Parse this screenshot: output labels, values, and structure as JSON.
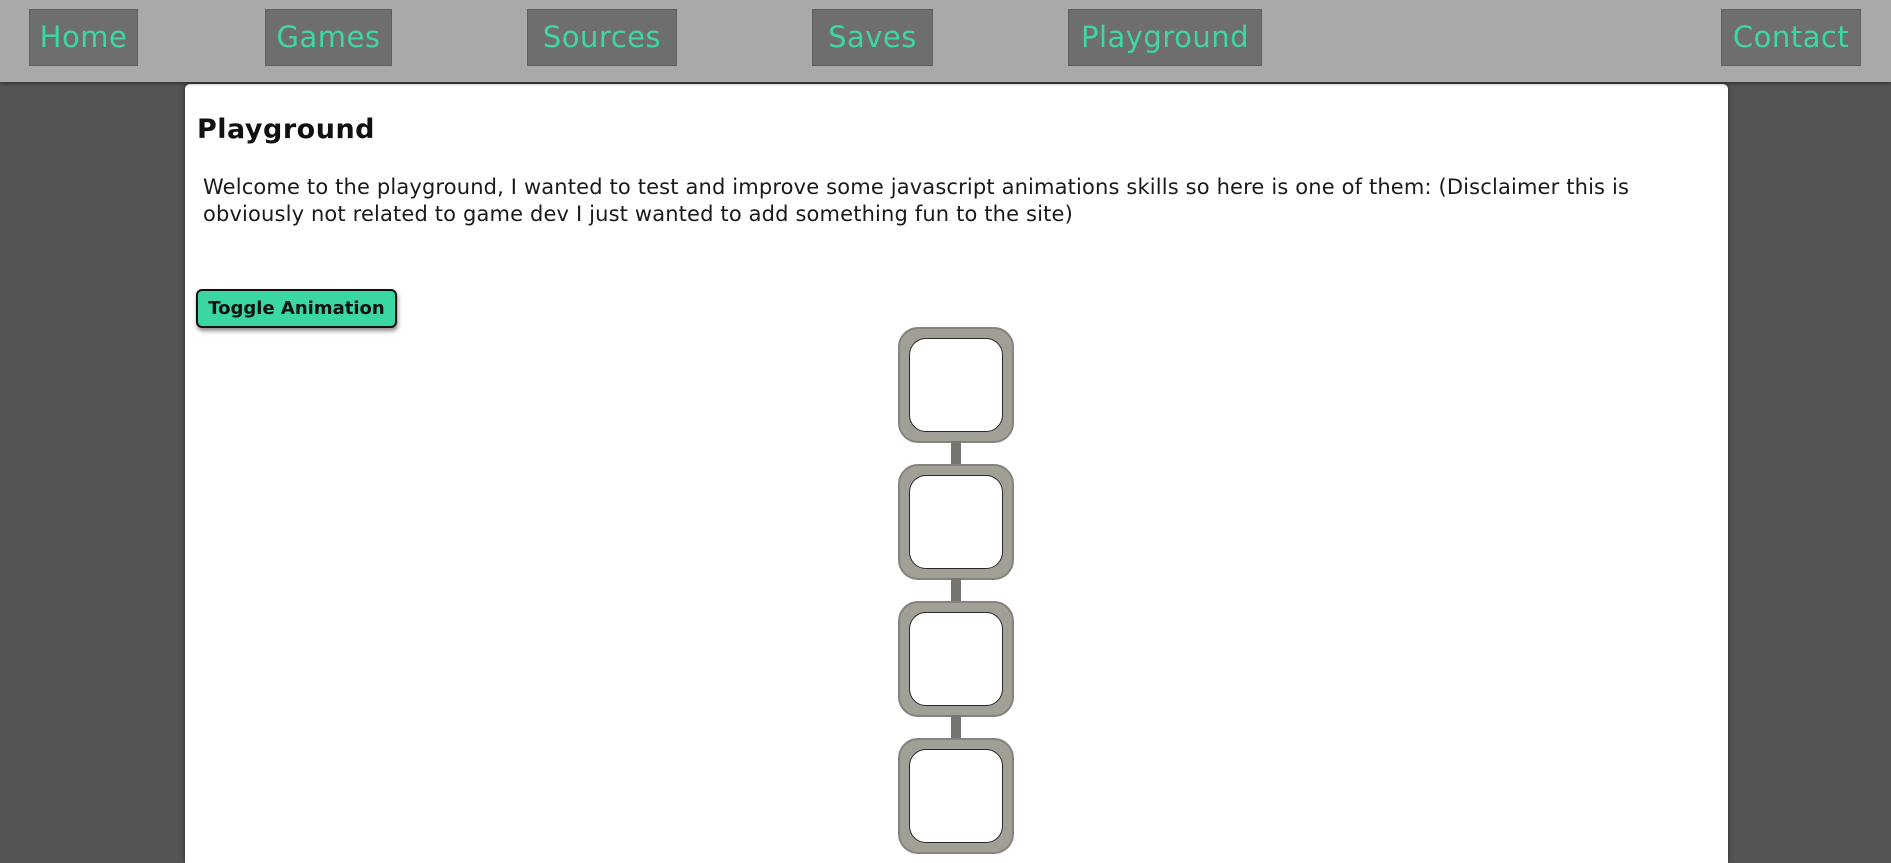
{
  "nav": {
    "items": [
      {
        "label": "Home"
      },
      {
        "label": "Games"
      },
      {
        "label": "Sources"
      },
      {
        "label": "Saves"
      },
      {
        "label": "Playground"
      },
      {
        "label": "Contact"
      }
    ]
  },
  "page": {
    "title": "Playground",
    "intro": "Welcome to the playground, I wanted to test and improve some javascript animations skills so here is one of them: (Disclaimer this is obviously not related to game dev I just wanted to add something fun to the site)",
    "toggle_label": "Toggle Animation"
  },
  "animation": {
    "tile_count": 4
  },
  "colors": {
    "accent": "#3fd6a6",
    "page_background": "#555555",
    "navbar_background": "#a9a9a9",
    "nav_button_background": "#6e6e6e",
    "tile_frame": "#a29f96",
    "connector": "#777570"
  }
}
